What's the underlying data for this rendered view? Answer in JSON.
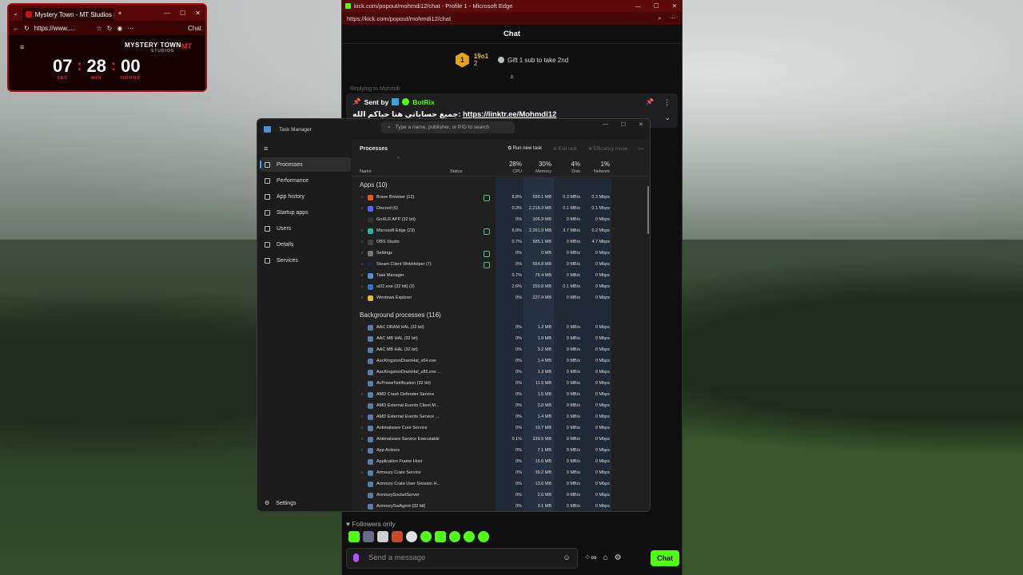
{
  "mini": {
    "tab_title": "Mystery Town - MT Studios | MTR",
    "url": "https://www....",
    "chat_label": "Chat",
    "brand": "MYSTERY TOWN",
    "brand_sub": "STUDIOS",
    "brand_mark": "MT",
    "timer": [
      {
        "value": "07",
        "label": "SEC"
      },
      {
        "value": "28",
        "label": "MIN"
      },
      {
        "value": "00",
        "label": "HOURS"
      }
    ]
  },
  "kick": {
    "title": "kick.com/popout/mohmdi12/chat - Profile 1 - Microsoft Edge",
    "url": "https://kick.com/popout/mohmdi12/chat",
    "header": "Chat",
    "leader_rank": "1",
    "leader_name": "19o1",
    "leader_count": "2",
    "gift_text": "Gift 1 sub to take 2nd",
    "reply_hint": "Replying to Mohmdi:",
    "sent_by": "Sent by",
    "bot_name": "BotRix",
    "pinned_text": "جميع حساباتي هنا حياكم الله:",
    "pinned_link": "https://linktr.ee/Mohmdi12",
    "followers_only": "Followers only",
    "placeholder": "Send a message",
    "chat_button": "Chat",
    "accent": "#53fc18"
  },
  "tm": {
    "title": "Task Manager",
    "search_placeholder": "Type a name, publisher, or PID to search",
    "nav": [
      {
        "label": "Processes",
        "icon": "processes-icon"
      },
      {
        "label": "Performance",
        "icon": "performance-icon"
      },
      {
        "label": "App history",
        "icon": "app-history-icon"
      },
      {
        "label": "Startup apps",
        "icon": "startup-icon"
      },
      {
        "label": "Users",
        "icon": "users-icon"
      },
      {
        "label": "Details",
        "icon": "details-icon"
      },
      {
        "label": "Services",
        "icon": "services-icon"
      }
    ],
    "settings": "Settings",
    "section_title": "Processes",
    "run_new_task": "Run new task",
    "end_task": "End task",
    "efficiency_mode": "Efficiency mode",
    "columns": {
      "name": "Name",
      "status": "Status",
      "cpu_pct": "28%",
      "cpu": "CPU",
      "mem_pct": "30%",
      "mem": "Memory",
      "disk_pct": "4%",
      "disk": "Disk",
      "net_pct": "1%",
      "net": "Network"
    },
    "apps_header": "Apps (10)",
    "apps": [
      {
        "name": "Brave Browser (12)",
        "cpu": "8.8%",
        "mem": "550.1 MB",
        "disk": "0.3 MB/s",
        "net": "0.3 Mbps",
        "exp": true,
        "status": true,
        "color": "#e2572b"
      },
      {
        "name": "Discord (6)",
        "cpu": "0.3%",
        "mem": "2,218.3 MB",
        "disk": "0.1 MB/s",
        "net": "0.1 Mbps",
        "exp": true,
        "status": false,
        "color": "#5865f2"
      },
      {
        "name": "GoXLR APP (32 bit)",
        "cpu": "0%",
        "mem": "106.9 MB",
        "disk": "0 MB/s",
        "net": "0 Mbps",
        "exp": false,
        "status": false,
        "color": "#333333"
      },
      {
        "name": "Microsoft Edge (23)",
        "cpu": "6.0%",
        "mem": "2,261.9 MB",
        "disk": "3.7 MB/s",
        "net": "0.2 Mbps",
        "exp": true,
        "status": true,
        "color": "#2bb5a0"
      },
      {
        "name": "OBS Studio",
        "cpu": "0.7%",
        "mem": "585.1 MB",
        "disk": "0 MB/s",
        "net": "4.7 Mbps",
        "exp": true,
        "status": false,
        "color": "#444444"
      },
      {
        "name": "Settings",
        "cpu": "0%",
        "mem": "0 MB",
        "disk": "0 MB/s",
        "net": "0 Mbps",
        "exp": true,
        "status": true,
        "color": "#777777"
      },
      {
        "name": "Steam Client WebHelper (7)",
        "cpu": "0%",
        "mem": "554.8 MB",
        "disk": "0 MB/s",
        "net": "0 Mbps",
        "exp": true,
        "status": true,
        "color": "#1b2838"
      },
      {
        "name": "Task Manager",
        "cpu": "0.7%",
        "mem": "76.4 MB",
        "disk": "0 MB/s",
        "net": "0 Mbps",
        "exp": true,
        "status": false,
        "color": "#4a8fd9"
      },
      {
        "name": "ui32.exe (32 bit) (3)",
        "cpu": "2.6%",
        "mem": "259.8 MB",
        "disk": "0.1 MB/s",
        "net": "0 Mbps",
        "exp": true,
        "status": false,
        "color": "#3a6fc4"
      },
      {
        "name": "Windows Explorer",
        "cpu": "0%",
        "mem": "227.4 MB",
        "disk": "0 MB/s",
        "net": "0 Mbps",
        "exp": true,
        "status": false,
        "color": "#e8b83a"
      }
    ],
    "bg_header": "Background processes (116)",
    "bg": [
      {
        "name": "AAC DRAM HAL (32 bit)",
        "cpu": "0%",
        "mem": "1.2 MB",
        "disk": "0 MB/s",
        "net": "0 Mbps",
        "exp": false
      },
      {
        "name": "AAC MB HAL (32 bit)",
        "cpu": "0%",
        "mem": "1.9 MB",
        "disk": "0 MB/s",
        "net": "0 Mbps",
        "exp": false
      },
      {
        "name": "AAC MB HAL (32 bit)",
        "cpu": "0%",
        "mem": "3.2 MB",
        "disk": "0 MB/s",
        "net": "0 Mbps",
        "exp": false
      },
      {
        "name": "AacKingstonDramHal_x64.exe",
        "cpu": "0%",
        "mem": "1.4 MB",
        "disk": "0 MB/s",
        "net": "0 Mbps",
        "exp": false
      },
      {
        "name": "AacKingstonDramHal_x86.exe ...",
        "cpu": "0%",
        "mem": "1.3 MB",
        "disk": "0 MB/s",
        "net": "0 Mbps",
        "exp": false
      },
      {
        "name": "AcPowerNotification (32 bit)",
        "cpu": "0%",
        "mem": "11.5 MB",
        "disk": "0 MB/s",
        "net": "0 Mbps",
        "exp": false
      },
      {
        "name": "AMD Crash Defender Service",
        "cpu": "0%",
        "mem": "1.5 MB",
        "disk": "0 MB/s",
        "net": "0 Mbps",
        "exp": true
      },
      {
        "name": "AMD External Events Client M...",
        "cpu": "0%",
        "mem": "3.8 MB",
        "disk": "0 MB/s",
        "net": "0 Mbps",
        "exp": false
      },
      {
        "name": "AMD External Events Service ...",
        "cpu": "0%",
        "mem": "1.4 MB",
        "disk": "0 MB/s",
        "net": "0 Mbps",
        "exp": true
      },
      {
        "name": "Antimalware Core Service",
        "cpu": "0%",
        "mem": "10.7 MB",
        "disk": "0 MB/s",
        "net": "0 Mbps",
        "exp": true
      },
      {
        "name": "Antimalware Service Executable",
        "cpu": "0.1%",
        "mem": "239.5 MB",
        "disk": "0 MB/s",
        "net": "0 Mbps",
        "exp": true
      },
      {
        "name": "App Actions",
        "cpu": "0%",
        "mem": "7.1 MB",
        "disk": "0 MB/s",
        "net": "0 Mbps",
        "exp": true
      },
      {
        "name": "Application Frame Host",
        "cpu": "0%",
        "mem": "15.6 MB",
        "disk": "0 MB/s",
        "net": "0 Mbps",
        "exp": false
      },
      {
        "name": "Armoury Crate Service",
        "cpu": "0%",
        "mem": "39.2 MB",
        "disk": "0 MB/s",
        "net": "0 Mbps",
        "exp": true
      },
      {
        "name": "Armoury Crate User Session H...",
        "cpu": "0%",
        "mem": "13.6 MB",
        "disk": "0 MB/s",
        "net": "0 Mbps",
        "exp": false
      },
      {
        "name": "ArmourySocketServer",
        "cpu": "0%",
        "mem": "2.6 MB",
        "disk": "0 MB/s",
        "net": "0 Mbps",
        "exp": false
      },
      {
        "name": "ArmourySwAgent (32 bit)",
        "cpu": "0%",
        "mem": "3.1 MB",
        "disk": "0 MB/s",
        "net": "0 Mbps",
        "exp": false
      }
    ]
  }
}
